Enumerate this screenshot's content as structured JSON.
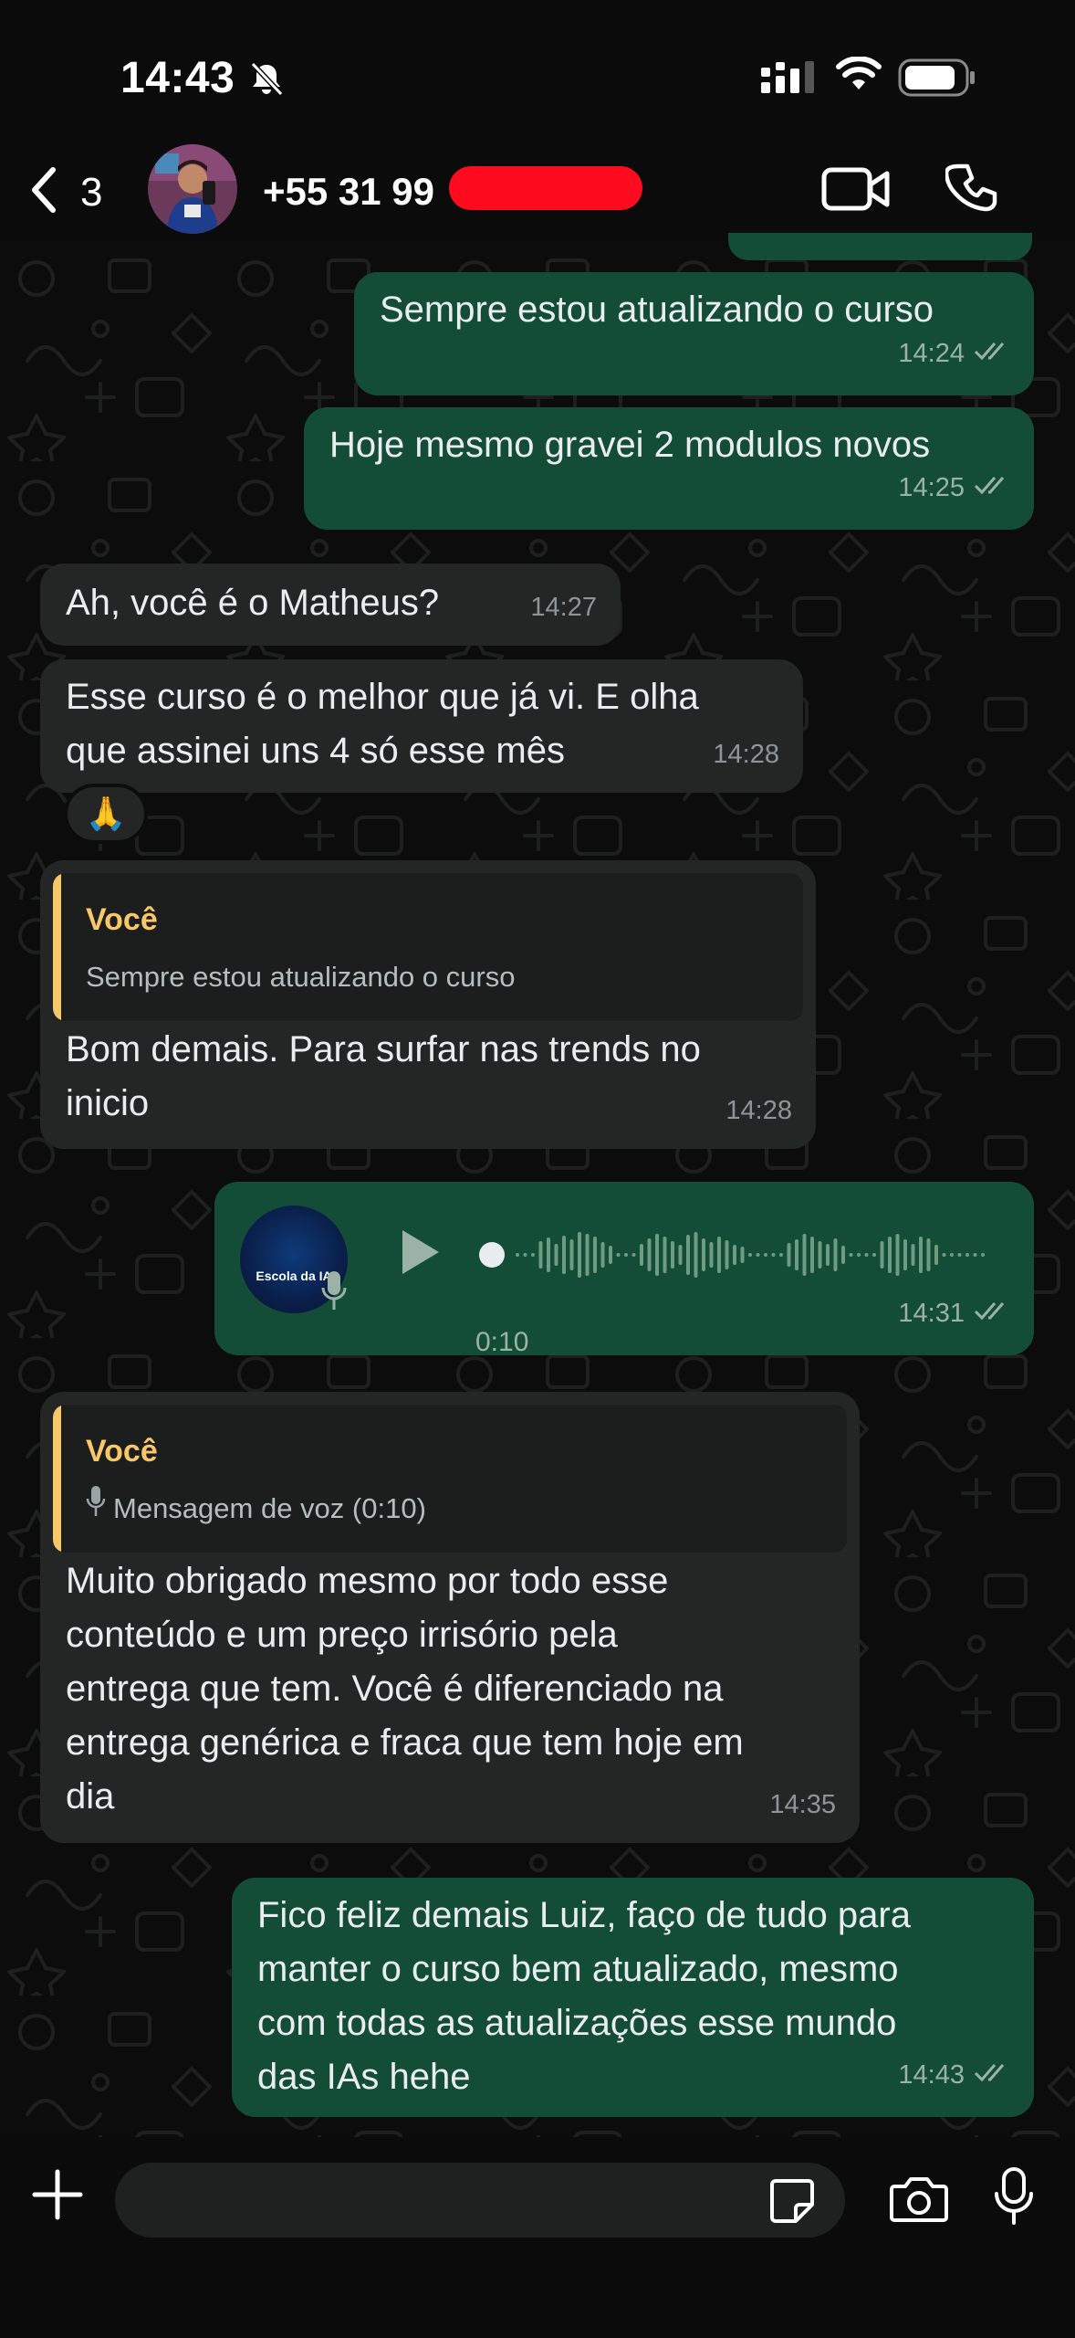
{
  "status_bar": {
    "time": "14:43"
  },
  "header": {
    "back_count": "3",
    "contact_name": "+55 31 99"
  },
  "colors": {
    "outgoing_bubble": "#134d37",
    "incoming_bubble": "#242626",
    "quote_accent": "#f7c768",
    "read_ticks": "#9bb3a6",
    "redaction": "#ff0b1f"
  },
  "messages": [
    {
      "direction": "out",
      "text": "Sempre estou atualizando o curso",
      "time": "14:24",
      "status": "read"
    },
    {
      "direction": "out",
      "text": "Hoje mesmo gravei 2 modulos novos",
      "time": "14:25",
      "status": "read"
    },
    {
      "direction": "in",
      "text": "Ah, você é o Matheus?",
      "time": "14:27"
    },
    {
      "direction": "in",
      "lines": [
        "Esse curso é o melhor que já vi. E olha",
        "que assinei uns 4 só esse mês"
      ],
      "time": "14:28",
      "reaction": "🙏"
    },
    {
      "direction": "in",
      "quote": {
        "author": "Você",
        "text": "Sempre estou atualizando o curso"
      },
      "lines": [
        "Bom demais. Para surfar nas trends no",
        "inicio"
      ],
      "time": "14:28"
    },
    {
      "direction": "out",
      "type": "voice",
      "avatar_label": "Escola da IA",
      "duration": "0:10",
      "time": "14:31",
      "status": "read"
    },
    {
      "direction": "in",
      "quote": {
        "author": "Você",
        "text": "Mensagem de voz (0:10)",
        "icon": "mic-icon"
      },
      "lines": [
        "Muito obrigado mesmo por todo esse",
        "conteúdo e um preço irrisório pela",
        "entrega que tem. Você é diferenciado na",
        "entrega genérica e fraca que tem hoje em",
        "dia"
      ],
      "time": "14:35"
    },
    {
      "direction": "out",
      "lines": [
        "Fico feliz demais Luiz, faço de tudo para",
        "manter o curso bem atualizado, mesmo",
        "com todas as atualizações esse mundo",
        "das IAs hehe"
      ],
      "time": "14:43",
      "status": "read"
    }
  ],
  "input": {
    "placeholder": "",
    "value": ""
  },
  "icons": {
    "status": [
      "bell-off-icon",
      "cellular-signal-icon",
      "wifi-icon",
      "battery-icon"
    ],
    "header": [
      "chevron-left-icon",
      "video-call-icon",
      "phone-icon"
    ],
    "input": [
      "plus-icon",
      "sticker-icon",
      "camera-icon",
      "mic-icon"
    ]
  }
}
